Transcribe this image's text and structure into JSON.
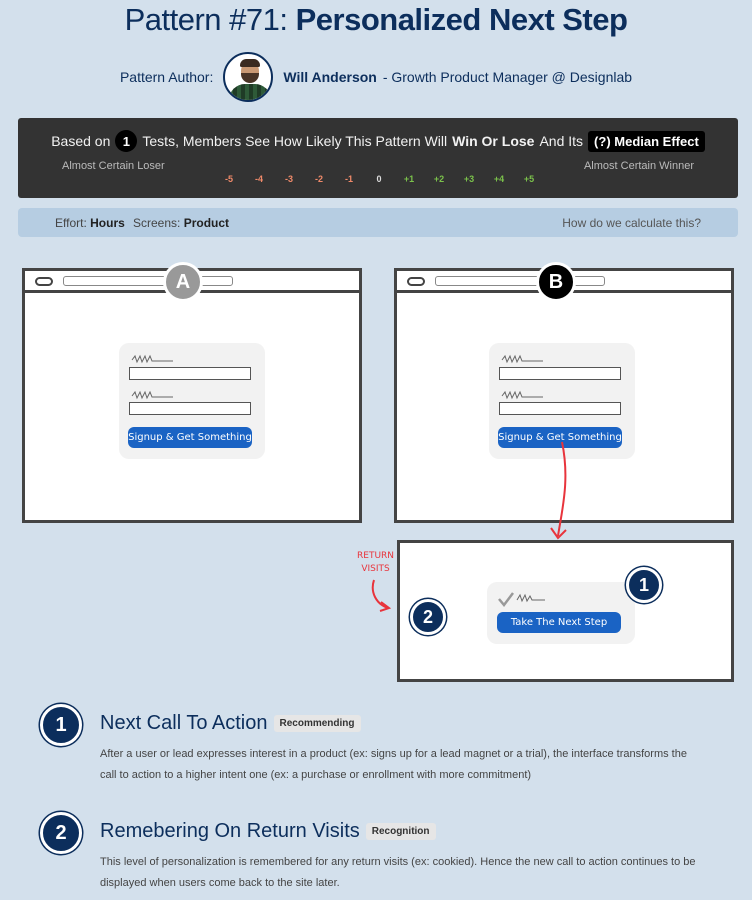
{
  "header": {
    "pattern_num": "Pattern #71:",
    "pattern_name": "Personalized Next Step",
    "author_label": "Pattern Author:",
    "author_name": "Will Anderson",
    "author_role": " - Growth Product Manager @ Designlab"
  },
  "winbar": {
    "prefix": "Based on",
    "tests": "1",
    "mid": "Tests, Members See How Likely This Pattern Will",
    "winlose": "Win Or Lose",
    "and": "And Its",
    "median": "(?) Median Effect",
    "loser": "Almost Certain Loser",
    "winner": "Almost Certain Winner",
    "scale": [
      {
        "label": "-5",
        "color": "#f08a6a"
      },
      {
        "label": "-4",
        "color": "#f08a6a"
      },
      {
        "label": "-3",
        "color": "#f08a6a"
      },
      {
        "label": "-2",
        "color": "#f08a6a"
      },
      {
        "label": "-1",
        "color": "#f08a6a"
      },
      {
        "label": "0",
        "color": "#dddddd"
      },
      {
        "label": "+1",
        "color": "#7bc24b"
      },
      {
        "label": "+2",
        "color": "#7bc24b"
      },
      {
        "label": "+3",
        "color": "#7bc24b"
      },
      {
        "label": "+4",
        "color": "#7bc24b"
      },
      {
        "label": "+5",
        "color": "#7bc24b"
      }
    ]
  },
  "effort": {
    "effort_label": "Effort:",
    "effort_value": "Hours",
    "screens_label": "Screens:",
    "screens_value": "Product",
    "how_link": "How do we calculate this?"
  },
  "diagram": {
    "variant_a": "A",
    "variant_b": "B",
    "signup_btn": "Signup & Get Something",
    "next_btn": "Take The Next Step",
    "return_label_1": "RETURN",
    "return_label_2": "VISITS",
    "badge_1": "1",
    "badge_2": "2"
  },
  "steps": [
    {
      "num": "1",
      "title": "Next Call To Action",
      "tag": "Recommending",
      "desc": "After a user or lead expresses interest in a product (ex: signs up for a lead magnet or a trial), the interface transforms the call to action to a higher intent one (ex: a purchase or enrollment with more commitment)"
    },
    {
      "num": "2",
      "title": "Remebering On Return Visits",
      "tag": "Recognition",
      "desc": "This level of personalization is remembered for any return visits (ex: cookied). Hence the new call to action continues to be displayed when users come back to the site later."
    }
  ],
  "colors": {
    "navy": "#0c2e5c",
    "cta_blue": "#1a63c4",
    "arrow_red": "#e8343c",
    "bar_dark": "#333333",
    "page_bg": "#d3e0ec"
  }
}
